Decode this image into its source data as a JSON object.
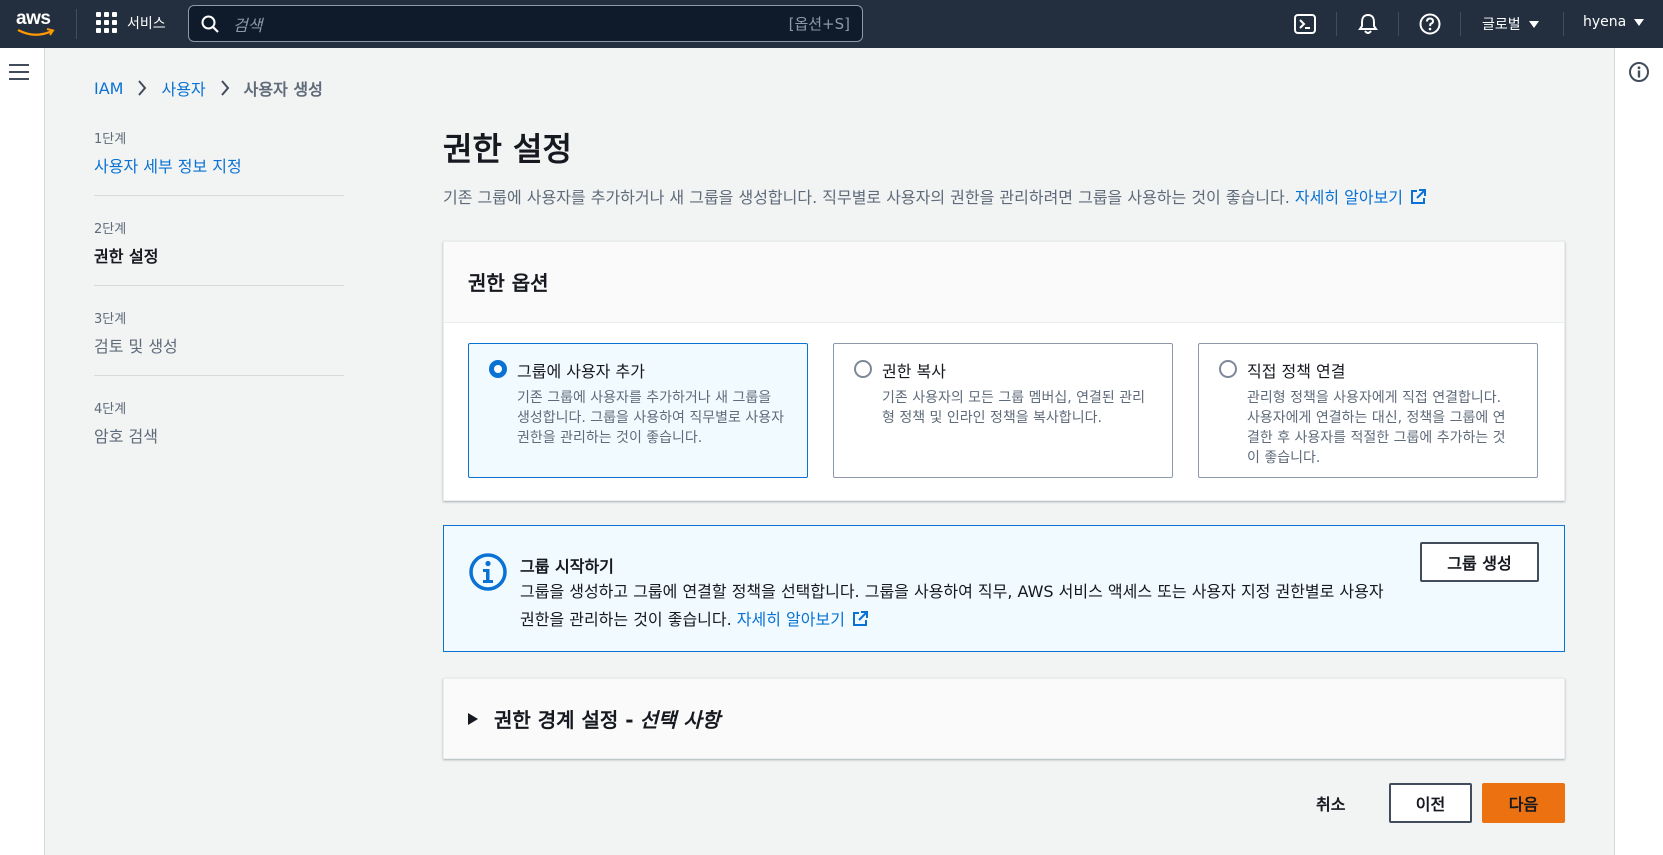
{
  "topnav": {
    "logo_text": "aws",
    "services_label": "서비스",
    "search_placeholder": "검색",
    "search_shortcut": "[옵션+S]",
    "icons": [
      "cloudshell-icon",
      "bell-icon",
      "help-icon"
    ],
    "region_label": "글로벌",
    "user_label": "hyena"
  },
  "breadcrumb": {
    "items": [
      "IAM",
      "사용자"
    ],
    "current": "사용자 생성"
  },
  "steps": [
    {
      "num": "1단계",
      "label": "사용자 세부 정보 지정"
    },
    {
      "num": "2단계",
      "label": "권한 설정"
    },
    {
      "num": "3단계",
      "label": "검토 및 생성"
    },
    {
      "num": "4단계",
      "label": "암호 검색"
    }
  ],
  "main": {
    "title": "권한 설정",
    "description": "기존 그룹에 사용자를 추가하거나 새 그룹을 생성합니다. 직무별로 사용자의 권한을 관리하려면 그룹을 사용하는 것이 좋습니다. ",
    "learn_more": "자세히 알아보기"
  },
  "permission_options": {
    "header": "권한 옵션",
    "selected_index": 0,
    "tiles": [
      {
        "title": "그룹에 사용자 추가",
        "desc": "기존 그룹에 사용자를 추가하거나 새 그룹을 생성합니다. 그룹을 사용하여 직무별로 사용자 권한을 관리하는 것이 좋습니다."
      },
      {
        "title": "권한 복사",
        "desc": "기존 사용자의 모든 그룹 멤버십, 연결된 관리형 정책 및 인라인 정책을 복사합니다."
      },
      {
        "title": "직접 정책 연결",
        "desc": "관리형 정책을 사용자에게 직접 연결합니다. 사용자에게 연결하는 대신, 정책을 그룹에 연결한 후 사용자를 적절한 그룹에 추가하는 것이 좋습니다."
      }
    ]
  },
  "alert": {
    "title": "그룹 시작하기",
    "body": "그룹을 생성하고 그룹에 연결할 정책을 선택합니다. 그룹을 사용하여 직무, AWS 서비스 액세스 또는 사용자 지정 권한별로 사용자 권한을 관리하는 것이 좋습니다. ",
    "learn_more": "자세히 알아보기",
    "button": "그룹 생성"
  },
  "boundary": {
    "title": "권한 경계 설정 -",
    "optional": "선택 사항"
  },
  "footer": {
    "cancel": "취소",
    "prev": "이전",
    "next": "다음"
  },
  "colors": {
    "nav_bg": "#232f3e",
    "link": "#0972d3",
    "primary_button": "#ec7211"
  }
}
